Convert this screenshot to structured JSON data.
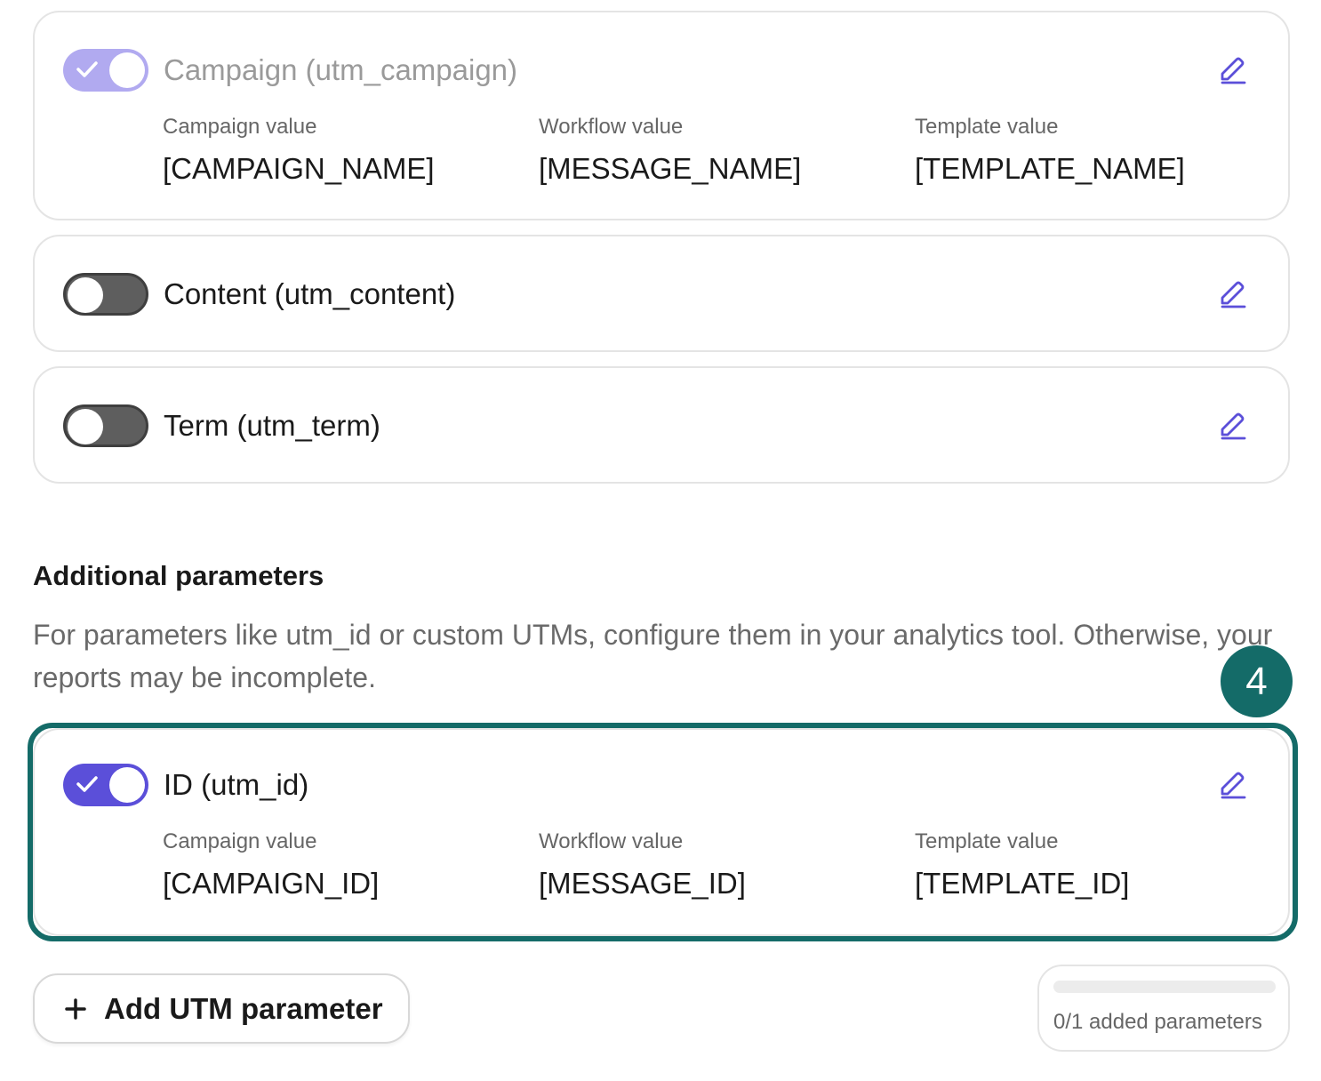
{
  "params": [
    {
      "title": "Campaign (utm_campaign)",
      "enabled": true,
      "disabled_state": true,
      "fields": [
        {
          "label": "Campaign value",
          "value": "[CAMPAIGN_NAME]"
        },
        {
          "label": "Workflow value",
          "value": "[MESSAGE_NAME]"
        },
        {
          "label": "Template value",
          "value": "[TEMPLATE_NAME]"
        }
      ]
    },
    {
      "title": "Content (utm_content)",
      "enabled": false
    },
    {
      "title": "Term (utm_term)",
      "enabled": false
    }
  ],
  "additional": {
    "title": "Additional parameters",
    "description": "For parameters like utm_id or custom UTMs, configure them in your analytics tool. Otherwise, your reports may be incomplete.",
    "step_badge": "4",
    "param": {
      "title": "ID (utm_id)",
      "enabled": true,
      "fields": [
        {
          "label": "Campaign value",
          "value": "[CAMPAIGN_ID]"
        },
        {
          "label": "Workflow value",
          "value": "[MESSAGE_ID]"
        },
        {
          "label": "Template value",
          "value": "[TEMPLATE_ID]"
        }
      ]
    }
  },
  "footer": {
    "add_button_icon": "plus-icon",
    "add_button_label": "Add UTM parameter",
    "progress_text": "0/1 added parameters",
    "progress_fraction": 0
  },
  "colors": {
    "accent": "#5b4fd9",
    "accent_dim": "#b1aaf0",
    "highlight": "#146b68",
    "toggle_off": "#5e5e5e"
  }
}
